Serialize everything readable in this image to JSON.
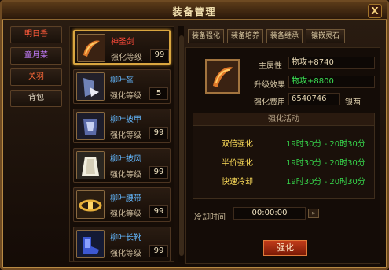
{
  "window": {
    "title": "装备管理",
    "close_label": "X"
  },
  "left_tabs": [
    "明日香",
    "童月菜",
    "关羽",
    "背包"
  ],
  "items": [
    {
      "name": "神圣剑",
      "level_label": "强化等级",
      "level": "99",
      "icon": "sword-icon"
    },
    {
      "name": "柳叶盔",
      "level_label": "强化等级",
      "level": "5",
      "icon": "helmet-icon"
    },
    {
      "name": "柳叶披甲",
      "level_label": "强化等级",
      "level": "99",
      "icon": "armor-icon"
    },
    {
      "name": "柳叶披风",
      "level_label": "强化等级",
      "level": "99",
      "icon": "cape-icon"
    },
    {
      "name": "柳叶腰带",
      "level_label": "强化等级",
      "level": "99",
      "icon": "belt-icon"
    },
    {
      "name": "柳叶长靴",
      "level_label": "强化等级",
      "level": "99",
      "icon": "boots-icon"
    }
  ],
  "right_tabs": [
    "装备强化",
    "装备培养",
    "装备继承",
    "镶嵌灵石"
  ],
  "detail": {
    "main_attr_label": "主属性",
    "main_attr_value": "物攻+8740",
    "upgrade_label": "升级效果",
    "upgrade_value": "物攻+8800",
    "cost_label": "强化费用",
    "cost_value": "6540746",
    "cost_unit": "银两"
  },
  "activity": {
    "header": "强化活动",
    "rows": [
      {
        "name": "双倍强化",
        "time": "19时30分 - 20时30分"
      },
      {
        "name": "半价强化",
        "time": "19时30分 - 20时30分"
      },
      {
        "name": "快速冷却",
        "time": "19时30分 - 20时30分"
      }
    ]
  },
  "cooldown": {
    "label": "冷却时间",
    "value": "00:00:00",
    "button": "»"
  },
  "enhance_button": "强化",
  "colors": {
    "accent_gold": "#d9a640",
    "red_button": "#c23c1a",
    "green_time": "#37d84c",
    "activity_name": "#ffde5a"
  }
}
